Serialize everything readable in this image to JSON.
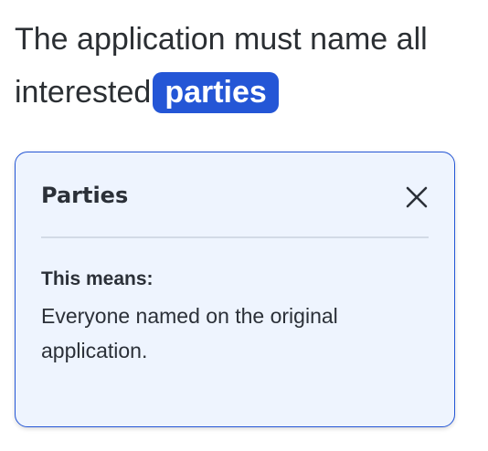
{
  "sentence": {
    "text": "The application must name all interested",
    "term": "parties"
  },
  "popover": {
    "title": "Parties",
    "close_icon": "close-icon",
    "meaning_label": "This means:",
    "definition": "Everyone named on the original application."
  },
  "colors": {
    "accent": "#2456d6",
    "popover_bg": "#eef4fe",
    "text": "#2b3038"
  }
}
